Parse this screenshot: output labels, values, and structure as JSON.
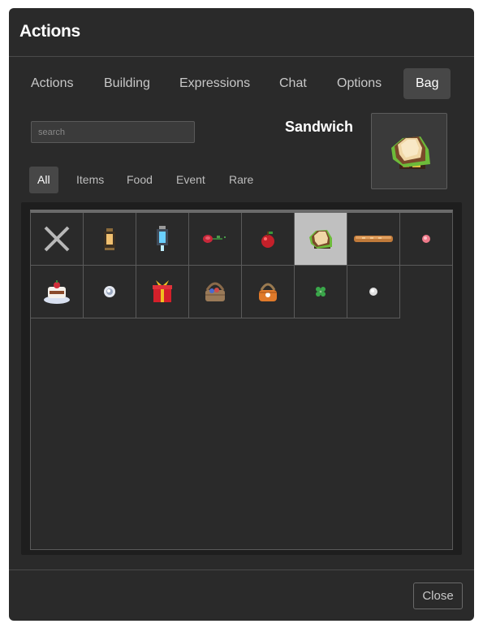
{
  "window": {
    "title": "Actions"
  },
  "tabs": [
    {
      "label": "Actions",
      "active": false
    },
    {
      "label": "Building",
      "active": false
    },
    {
      "label": "Expressions",
      "active": false
    },
    {
      "label": "Chat",
      "active": false
    },
    {
      "label": "Options",
      "active": false
    },
    {
      "label": "Bag",
      "active": true
    }
  ],
  "search": {
    "placeholder": "search",
    "value": ""
  },
  "selected_item": {
    "name": "Sandwich",
    "icon": "sandwich-icon"
  },
  "filters": [
    {
      "label": "All",
      "active": true
    },
    {
      "label": "Items",
      "active": false
    },
    {
      "label": "Food",
      "active": false
    },
    {
      "label": "Event",
      "active": false
    },
    {
      "label": "Rare",
      "active": false
    }
  ],
  "inventory": {
    "items": [
      {
        "icon": "unequip-x-icon",
        "selected": false
      },
      {
        "icon": "lantern-icon",
        "selected": false
      },
      {
        "icon": "ice-lantern-icon",
        "selected": false
      },
      {
        "icon": "rose-icon",
        "selected": false
      },
      {
        "icon": "apple-icon",
        "selected": false
      },
      {
        "icon": "sandwich-icon",
        "selected": true
      },
      {
        "icon": "baguette-icon",
        "selected": false
      },
      {
        "icon": "pink-orb-icon",
        "selected": false
      },
      {
        "icon": "cake-icon",
        "selected": false
      },
      {
        "icon": "white-orb-icon",
        "selected": false
      },
      {
        "icon": "gift-box-icon",
        "selected": false
      },
      {
        "icon": "basket-icon",
        "selected": false
      },
      {
        "icon": "orange-basket-icon",
        "selected": false
      },
      {
        "icon": "clover-icon",
        "selected": false
      },
      {
        "icon": "small-white-orb-icon",
        "selected": false
      }
    ]
  },
  "footer": {
    "close_label": "Close"
  },
  "colors": {
    "panel": "#2a2a2a",
    "active_tab": "#474747",
    "selected_cell": "#c0c0c0"
  }
}
